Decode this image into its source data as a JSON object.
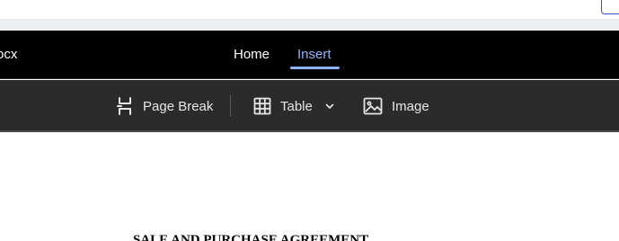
{
  "header": {
    "file_name": "ocx",
    "tabs": [
      {
        "label": "Home",
        "active": false
      },
      {
        "label": "Insert",
        "active": true
      }
    ],
    "accent_color": "#8fb4ff"
  },
  "toolbar": {
    "page_break_label": "Page Break",
    "table_label": "Table",
    "image_label": "Image"
  },
  "document": {
    "title": "SALE AND PURCHASE AGREEMENT"
  }
}
